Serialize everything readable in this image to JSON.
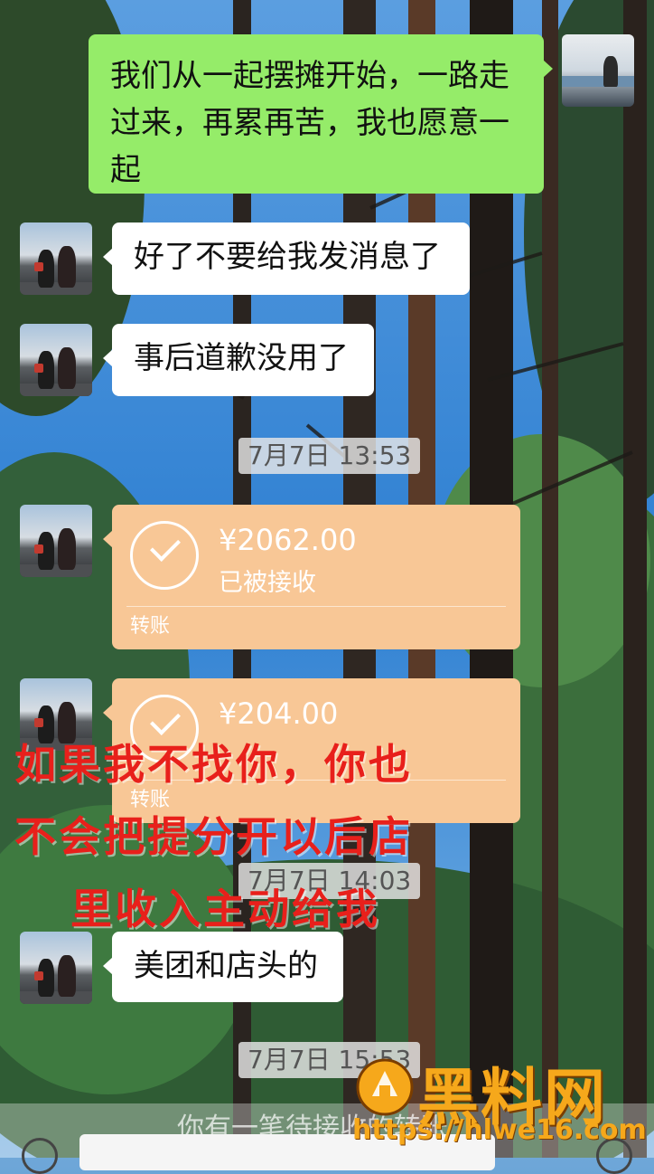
{
  "messages": {
    "sent_1": "我们从一起摆摊开始，一路走过来，再累再苦，我也愿意一起",
    "recv_1": "好了不要给我发消息了",
    "recv_2": "事后道歉没用了",
    "recv_3": "美团和店头的"
  },
  "timestamps": {
    "t1": "7月7日 13:53",
    "t2": "7月7日 14:03",
    "t3": "7月7日 15:53"
  },
  "transfers": [
    {
      "amount": "¥2062.00",
      "status": "已被接收",
      "label": "转账"
    },
    {
      "amount": "¥204.00",
      "status": "",
      "label": "转账"
    }
  ],
  "overlay": {
    "line1": "如果我不找你，你也",
    "line2": "不会把提分开以后店",
    "line3": "里收入主动给我"
  },
  "footer": {
    "partial_system_text": "你有一笔待接收的转账"
  },
  "watermark": {
    "brand": "黑料网",
    "url": "https://hlwe16.com"
  },
  "icons": {
    "check": "check-circle-icon",
    "voice": "voice-icon",
    "plus": "plus-icon"
  },
  "colors": {
    "sent_bubble": "#95ec69",
    "recv_bubble": "#ffffff",
    "transfer_bubble": "#f8c796",
    "overlay_text": "#e8201b",
    "watermark": "#f6a81b"
  }
}
